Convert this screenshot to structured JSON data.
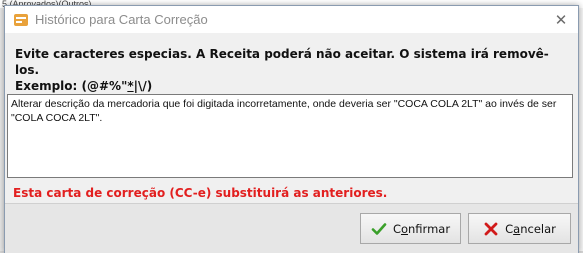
{
  "background": {
    "top_strip_text": "5   (Aprovados)(Outros)"
  },
  "dialog": {
    "title": "Histórico para Carta Correção",
    "close_glyph": "✕",
    "warning_line1": "Evite caracteres especias. A Receita poderá não aceitar. O sistema irá removê-los.",
    "warning_line2_prefix": "Exemplo:  (@#%\"",
    "warning_line2_star": "*",
    "warning_line2_suffix": "|\\/)",
    "textarea_value": "Alterar descrição da mercadoria que foi digitada incorretamente, onde deveria ser \"COCA COLA 2LT\" ao invés de ser \"COLA COCA 2LT\".",
    "notice": "Esta carta de correção (CC-e) substituirá as anteriores."
  },
  "buttons": {
    "confirm": {
      "hotkey": "o",
      "pre": "C",
      "post": "nfirmar",
      "icon": "check-icon"
    },
    "cancel": {
      "hotkey": "a",
      "pre": "C",
      "post": "ncelar",
      "icon": "x-icon"
    }
  },
  "colors": {
    "notice": "#e21f1f",
    "check_icon": "#3aa02a",
    "cancel_icon": "#d11a1a",
    "title_text": "#8c8c8c"
  }
}
